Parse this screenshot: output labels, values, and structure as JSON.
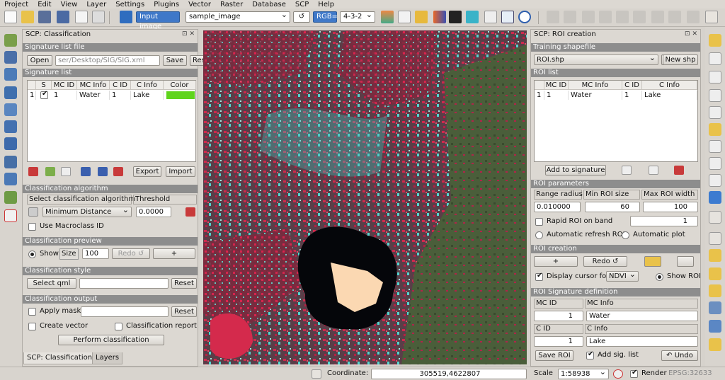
{
  "menu": [
    "Project",
    "Edit",
    "View",
    "Layer",
    "Settings",
    "Plugins",
    "Vector",
    "Raster",
    "Database",
    "SCP",
    "Help"
  ],
  "toolbar": {
    "input_image_label": "Input image",
    "image_select": "sample_image",
    "refresh_icon": "↺",
    "rgb_label": "RGB=",
    "band_combo": "4-3-2"
  },
  "left_panel": {
    "title": "SCP: Classification",
    "signature_file_section": "Signature list file",
    "open_label": "Open",
    "path_value": "ser/Desktop/SIG/SIG.xml",
    "save_label": "Save",
    "reset_label": "Reset",
    "signature_list_section": "Signature list",
    "sig_headers": [
      "S",
      "MC ID",
      "MC Info",
      "C ID",
      "C Info",
      "Color"
    ],
    "sig_rows": [
      {
        "num": "1",
        "checked": true,
        "mc_id": "1",
        "mc_info": "Water",
        "c_id": "1",
        "c_info": "Lake",
        "color": "#5fd41c"
      }
    ],
    "export_label": "Export",
    "import_label": "Import",
    "algorithm_section": "Classification algorithm",
    "select_algo_label": "Select classification algorithm",
    "threshold_label": "Threshold",
    "algorithm": "Minimum Distance",
    "threshold_value": "0.0000",
    "macroclass_label": "Use Macroclass ID",
    "preview_section": "Classification preview",
    "show_label": "Show",
    "size_label": "Size",
    "size_value": "100",
    "redo_label": "Redo ↺",
    "plus_label": "+",
    "style_section": "Classification style",
    "select_qml_label": "Select qml",
    "style_reset_label": "Reset",
    "output_section": "Classification output",
    "apply_mask_label": "Apply mask",
    "mask_reset_label": "Reset",
    "create_vector_label": "Create vector",
    "class_report_label": "Classification report",
    "perform_label": "Perform classification",
    "tabs": [
      "SCP: Classification",
      "Layers"
    ]
  },
  "right_panel": {
    "title": "SCP: ROI creation",
    "training_section": "Training shapefile",
    "shapefile": "ROI.shp",
    "new_shp_label": "New shp",
    "roi_list_section": "ROI list",
    "roi_headers": [
      "MC ID",
      "MC Info",
      "C ID",
      "C Info"
    ],
    "roi_rows": [
      {
        "num": "1",
        "mc_id": "1",
        "mc_info": "Water",
        "c_id": "1",
        "c_info": "Lake"
      }
    ],
    "add_to_signature_label": "Add to signature",
    "params_section": "ROI parameters",
    "range_radius_label": "Range radius",
    "min_roi_label": "Min ROI size",
    "max_roi_label": "Max ROI width",
    "range_radius_value": "0.010000",
    "min_roi_value": "60",
    "max_roi_value": "100",
    "rapid_roi_label": "Rapid ROI on band",
    "rapid_band_value": "1",
    "auto_refresh_label": "Automatic refresh ROI",
    "auto_plot_label": "Automatic  plot",
    "creation_section": "ROI creation",
    "plus_label": "+",
    "redo_label": "Redo ↺",
    "display_cursor_label": "Display cursor for",
    "cursor_index": "NDVI",
    "show_roi_label": "Show ROI",
    "sig_def_section": "ROI Signature definition",
    "mc_id_label": "MC ID",
    "mc_info_label": "MC Info",
    "mc_id_value": "1",
    "mc_info_value": "Water",
    "c_id_label": "C ID",
    "c_info_label": "C Info",
    "c_id_value": "1",
    "c_info_value": "Lake",
    "save_roi_label": "Save ROI",
    "add_sig_label": "Add sig. list",
    "undo_label": "↶ Undo"
  },
  "status": {
    "coordinate_label": "Coordinate:",
    "coordinate_value": "305519,4622807",
    "scale_label": "Scale",
    "scale_value": "1:58938",
    "render_label": "Render",
    "epsg": "EPSG:32633"
  },
  "colors": {
    "section_header": "#8d8d8d",
    "highlight": "#3f78c8",
    "signature_color": "#5fd41c"
  }
}
